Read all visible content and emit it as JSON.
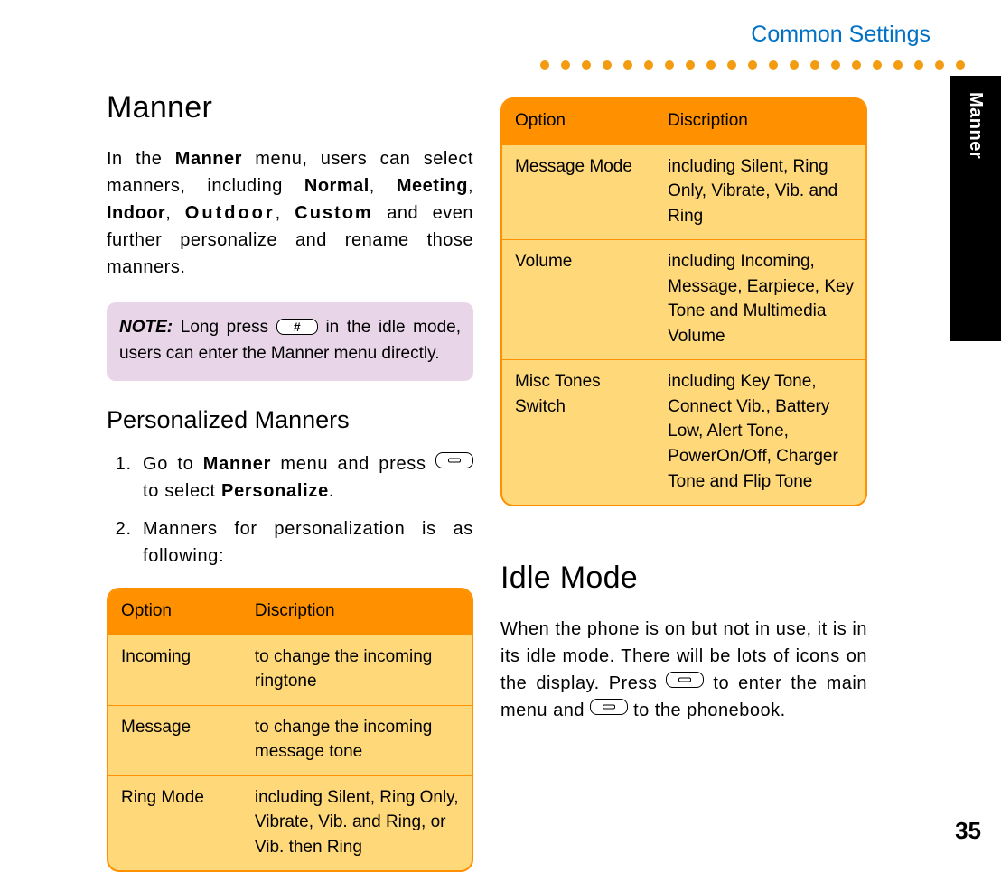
{
  "header": {
    "breadcrumb": "Common Settings"
  },
  "edgeTab": {
    "label": "Manner"
  },
  "pageNumber": "35",
  "left": {
    "h1": "Manner",
    "intro": {
      "p1a": "In the ",
      "p1b_bold": "Manner",
      "p1c": " menu, users can select manners, including ",
      "b1": "Normal",
      "s1": ", ",
      "b2": "Meeting",
      "s2": ", ",
      "b3": "Indoor",
      "s3": ", ",
      "b4": "Outdoor",
      "s4": ", ",
      "b5": "Custom",
      "tail": " and even further personalize and rename those manners."
    },
    "note": {
      "label": "NOTE:",
      "before": " Long press ",
      "after": " in the idle mode, users can enter the Manner menu directly."
    },
    "h2": "Personalized Manners",
    "steps": {
      "s1a": "Go to ",
      "s1b_bold": "Manner",
      "s1c": " menu and press ",
      "s1d": "  to select ",
      "s1e_bold": "Personalize",
      "s1f": ".",
      "s2": "Manners for personalization is as following:"
    },
    "table": {
      "head": {
        "c1": "Option",
        "c2": "Discription"
      },
      "rows": [
        {
          "c1": "Incoming",
          "c2": "to change the incoming ringtone"
        },
        {
          "c1": "Message",
          "c2": "to change the incoming message tone"
        },
        {
          "c1": "Ring Mode",
          "c2": "including Silent, Ring Only, Vibrate, Vib. and Ring, or Vib. then Ring"
        }
      ]
    }
  },
  "right": {
    "table": {
      "head": {
        "c1": "Option",
        "c2": "Discription"
      },
      "rows": [
        {
          "c1": "Message Mode",
          "c2": " including Silent, Ring Only, Vibrate, Vib. and Ring"
        },
        {
          "c1": "Volume",
          "c2": "including Incoming, Message, Earpiece, Key Tone and Multimedia Volume"
        },
        {
          "c1": "Misc Tones Switch",
          "c2": "including Key Tone, Connect Vib., Battery Low, Alert Tone, PowerOn/Off, Charger Tone and Flip Tone"
        }
      ]
    },
    "idle": {
      "h1": "Idle Mode",
      "p_a": "When the phone is on but not in use, it is in its idle mode. There will be lots of icons on the display. Press ",
      "p_b": " to enter the main menu and ",
      "p_c": " to the phonebook."
    }
  }
}
